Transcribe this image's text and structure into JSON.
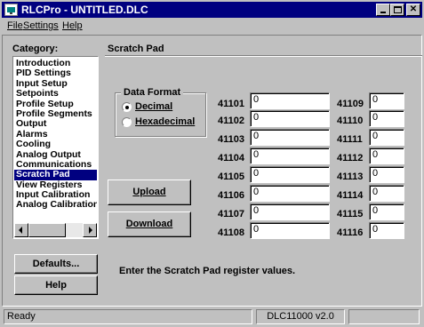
{
  "window": {
    "title": "RLCPro - UNTITLED.DLC"
  },
  "menu": {
    "file": "File",
    "settings": "Settings",
    "help": "Help"
  },
  "sidebar": {
    "heading": "Category:",
    "items": [
      "Introduction",
      "PID Settings",
      "Input Setup",
      "Setpoints",
      "Profile Setup",
      "Profile Segments",
      "Output",
      "Alarms",
      "Cooling",
      "Analog Output",
      "Communications",
      "Scratch Pad",
      "View Registers",
      "Input Calibration",
      "Analog Calibration"
    ],
    "selected": "Scratch Pad",
    "defaults_button": "Defaults...",
    "help_button": "Help"
  },
  "panel": {
    "title": "Scratch Pad",
    "data_format": {
      "legend": "Data Format",
      "options": [
        "Decimal",
        "Hexadecimal"
      ],
      "selected": "Decimal"
    },
    "upload_button": "Upload",
    "download_button": "Download",
    "registers_left": [
      {
        "label": "41101",
        "value": "0"
      },
      {
        "label": "41102",
        "value": "0"
      },
      {
        "label": "41103",
        "value": "0"
      },
      {
        "label": "41104",
        "value": "0"
      },
      {
        "label": "41105",
        "value": "0"
      },
      {
        "label": "41106",
        "value": "0"
      },
      {
        "label": "41107",
        "value": "0"
      },
      {
        "label": "41108",
        "value": "0"
      }
    ],
    "registers_right": [
      {
        "label": "41109",
        "value": "0"
      },
      {
        "label": "41110",
        "value": "0"
      },
      {
        "label": "41111",
        "value": "0"
      },
      {
        "label": "41112",
        "value": "0"
      },
      {
        "label": "41113",
        "value": "0"
      },
      {
        "label": "41114",
        "value": "0"
      },
      {
        "label": "41115",
        "value": "0"
      },
      {
        "label": "41116",
        "value": "0"
      }
    ],
    "instruction": "Enter the Scratch Pad register values."
  },
  "statusbar": {
    "status": "Ready",
    "version": "DLC11000 v2.0"
  }
}
